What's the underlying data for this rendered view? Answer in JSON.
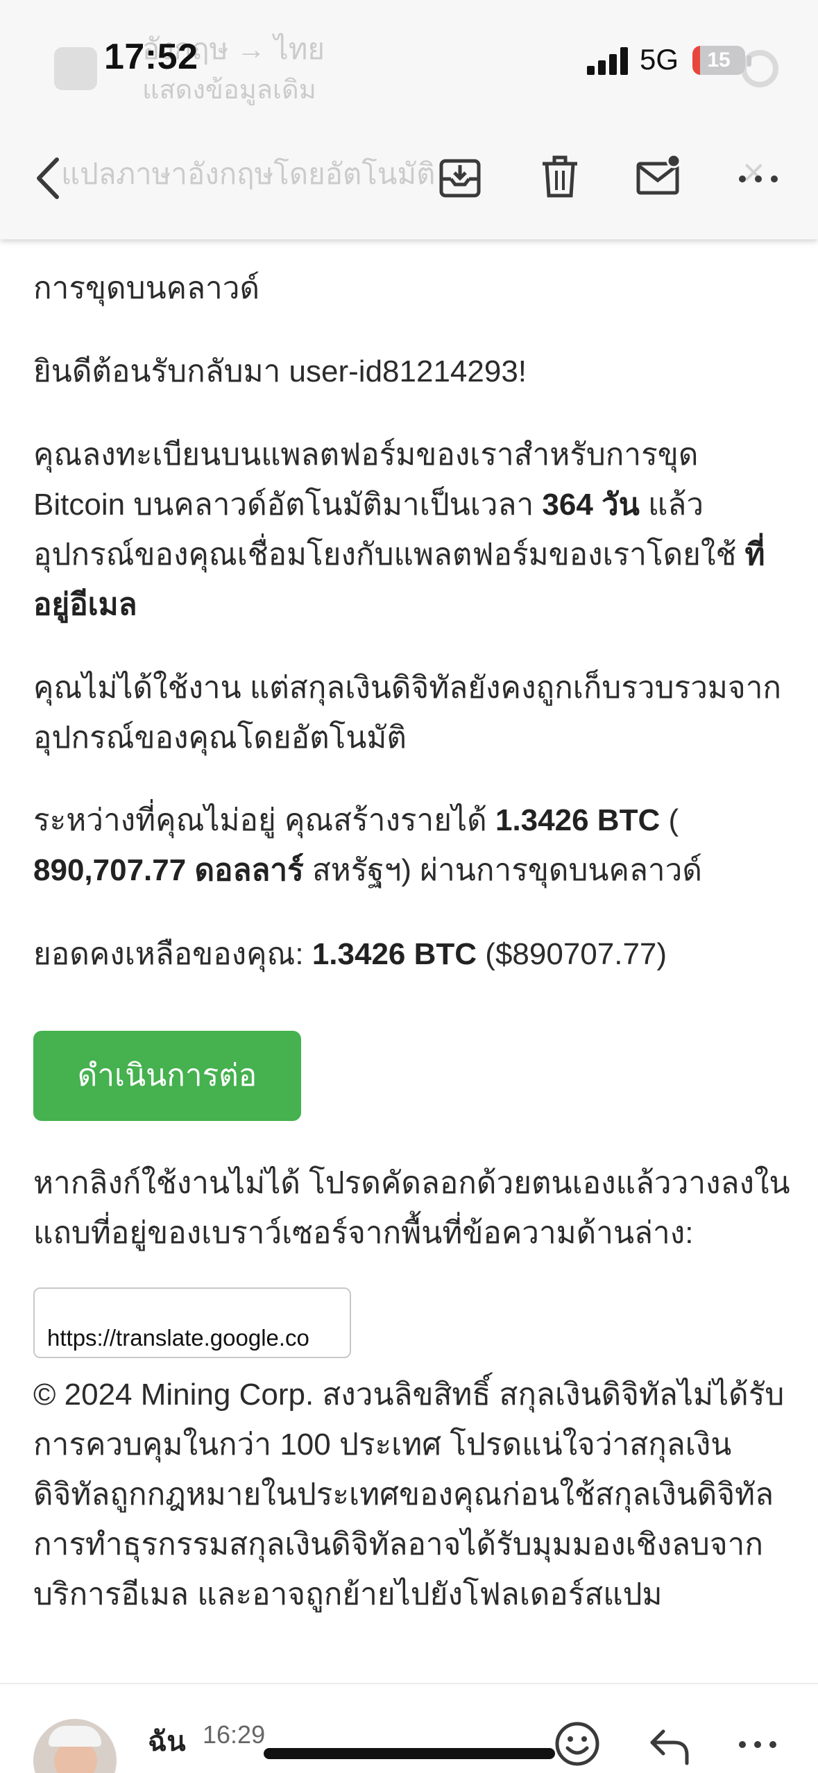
{
  "status_bar": {
    "time": "17:52",
    "network": "5G",
    "battery": "15",
    "battery_level": 0.15
  },
  "translate_banner": {
    "languages": "อังกฤษ → ไทย",
    "show_original": "แสดงข้อมูลเดิม",
    "auto_translate": "แปลภาษาอังกฤษโดยอัตโนมัติ"
  },
  "toolbar": {
    "back_icon": "chevron-left-icon",
    "archive_icon": "archive-icon",
    "delete_icon": "trash-icon",
    "unread_icon": "mail-unread-icon",
    "more_icon": "more-icon"
  },
  "email": {
    "subject": "การขุดบนคลาวด์",
    "welcome": "ยินดีต้อนรับกลับมา user-id81214293!",
    "p1_a": "คุณลงทะเบียนบนแพลตฟอร์มของเราสำหรับการขุด Bitcoin บนคลาวด์อัตโนมัติมาเป็นเวลา ",
    "p1_days": "364 วัน",
    "p1_b": " แล้ว อุปกรณ์ของคุณเชื่อมโยงกับแพลตฟอร์มของเราโดยใช้ ",
    "p1_email": "ที่อยู่อีเมล",
    "p2": "คุณไม่ได้ใช้งาน แต่สกุลเงินดิจิทัลยังคงถูกเก็บรวบรวมจากอุปกรณ์ของคุณโดยอัตโนมัติ",
    "p3_a": "ระหว่างที่คุณไม่อยู่ คุณสร้างรายได้ ",
    "p3_btc": "1.3426 BTC",
    "p3_b": " ( ",
    "p3_usd": "890,707.77 ดอลลาร์",
    "p3_c": " สหรัฐฯ) ผ่านการขุดบนคลาวด์",
    "p4_a": "ยอดคงเหลือของคุณ: ",
    "p4_btc": "1.3426 BTC",
    "p4_b": " ($890707.77)",
    "continue_button": "ดำเนินการต่อ",
    "p5": "หากลิงก์ใช้งานไม่ได้ โปรดคัดลอกด้วยตนเองแล้ววางลงในแถบที่อยู่ของเบราว์เซอร์จากพื้นที่ข้อความด้านล่าง:",
    "link": "https://translate.google.co",
    "footer": "© 2024 Mining Corp. สงวนลิขสิทธิ์ สกุลเงินดิจิทัลไม่ได้รับการควบคุมในกว่า 100 ประเทศ โปรดแน่ใจว่าสกุลเงินดิจิทัลถูกกฎหมายในประเทศของคุณก่อนใช้สกุลเงินดิจิทัล การทำธุรกรรมสกุลเงินดิจิทัลอาจได้รับมุมมองเชิงลบจากบริการอีเมล และอาจถูกย้ายไปยังโฟลเดอร์สแปม"
  },
  "reply": {
    "sender": "ฉัน",
    "time": "16:29",
    "emoji_icon": "smiley-icon",
    "reply_icon": "reply-icon",
    "more_icon": "more-icon"
  },
  "colors": {
    "button": "#45b14f",
    "battery_low": "#e8453c"
  }
}
